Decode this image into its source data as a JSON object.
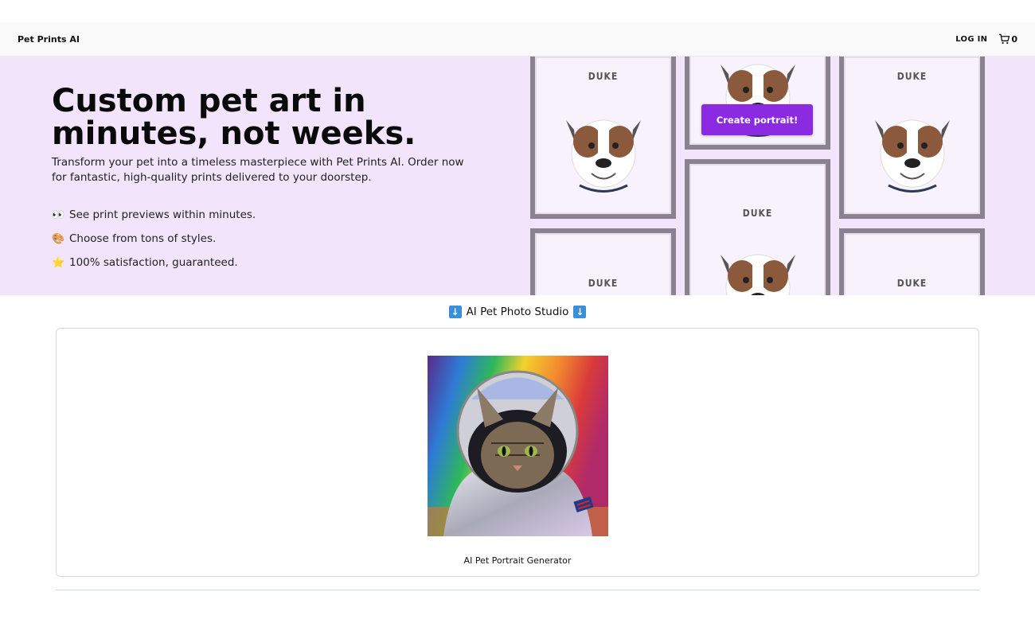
{
  "nav": {
    "brand": "Pet Prints AI",
    "login_label": "LOG IN",
    "cart_count": "0"
  },
  "hero": {
    "title": "Custom pet art in minutes, not weeks.",
    "subtitle": "Transform your pet into a timeless masterpiece with Pet Prints AI. Order now for fantastic, high-quality prints delivered to your doorstep.",
    "features": [
      {
        "icon": "eyes-icon",
        "emoji": "👀",
        "text": "See print previews within minutes."
      },
      {
        "icon": "palette-icon",
        "emoji": "🎨",
        "text": "Choose from tons of styles."
      },
      {
        "icon": "star-icon",
        "emoji": "⭐",
        "text": "100% satisfaction, guaranteed."
      }
    ],
    "frame_label": "DUKE",
    "cta_label": "Create portrait!"
  },
  "studio": {
    "heading": "AI Pet Photo Studio",
    "card_caption": "AI Pet Portrait Generator"
  },
  "colors": {
    "hero_bg": "#f2e4fb",
    "cta": "#8a2be2",
    "frame": "#8a8290"
  }
}
